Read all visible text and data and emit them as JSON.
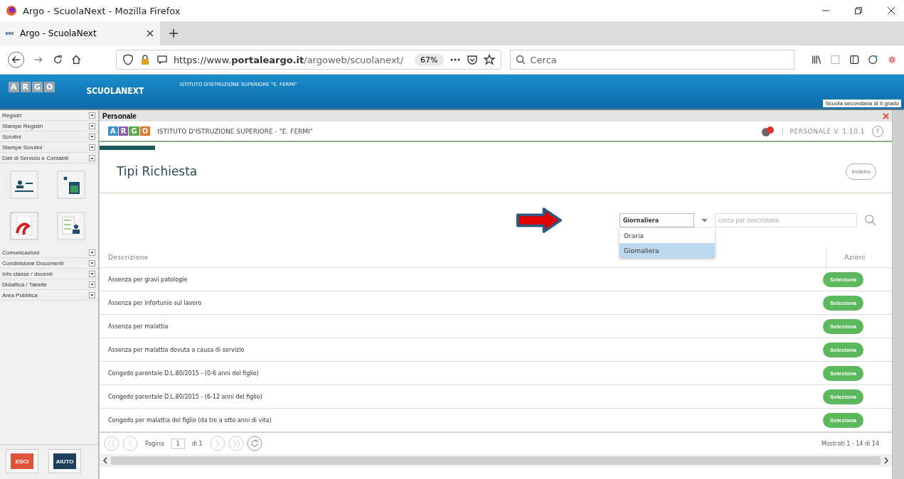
{
  "browser": {
    "window_title": "Argo - ScuolaNext - Mozilla Firefox",
    "tab_title": "Argo - ScuolaNext",
    "url_prefix": "https://www.",
    "url_domain": "portaleargo.it",
    "url_path": "/argoweb/scuolanext/",
    "zoom": "67%",
    "search_placeholder": "Cerca"
  },
  "app_header": {
    "logo_letters": [
      "A",
      "R",
      "G",
      "O"
    ],
    "product": "SCUOLANEXT",
    "school": "ISTITUTO D'ISTRUZIONE SUPERIORE \"E. FERMI\"",
    "school_level": "Scuola secondaria di II grado"
  },
  "sidebar": {
    "items": [
      {
        "label": "Registri",
        "expanded": false
      },
      {
        "label": "Stampe Registri",
        "expanded": false
      },
      {
        "label": "Scrutini",
        "expanded": false
      },
      {
        "label": "Stampe Scrutini",
        "expanded": false
      },
      {
        "label": "Dati di Servizio e Contabili",
        "expanded": true
      },
      {
        "label": "Comunicazioni",
        "expanded": false
      },
      {
        "label": "Condivisione Documenti",
        "expanded": false
      },
      {
        "label": "Info classe / docenti",
        "expanded": false
      },
      {
        "label": "Didattica / Tabelle",
        "expanded": false
      },
      {
        "label": "Area Pubblica",
        "expanded": false
      }
    ],
    "bottom_buttons": [
      {
        "label": "ESCI",
        "kind": "exit"
      },
      {
        "label": "AIUTO",
        "kind": "help"
      }
    ]
  },
  "panel": {
    "title": "Personale",
    "logo_letters": [
      {
        "letter": "A",
        "color": "#3a8fd0"
      },
      {
        "letter": "R",
        "color": "#8a5bb5"
      },
      {
        "letter": "G",
        "color": "#5aa84a"
      },
      {
        "letter": "O",
        "color": "#e8742c"
      }
    ],
    "school": "ISTITUTO D'ISTRUZIONE SUPERIORE - \"E. FERMI\"",
    "version": "PERSONALE V. 1.10.1",
    "help": "?",
    "progress": {
      "level": 0.07
    },
    "page_title": "Tipi Richiesta",
    "back_button": "Indietro",
    "filter": {
      "select_value": "Giornaliera",
      "options": [
        {
          "label": "Oraria",
          "selected": false
        },
        {
          "label": "Giornaliera",
          "selected": true
        }
      ],
      "search_placeholder": "cerca per descrizione"
    },
    "table": {
      "columns": [
        "Descrizione",
        "Azioni"
      ],
      "rows": [
        {
          "description": "Assenza per gravi patologie",
          "action": "Seleziona"
        },
        {
          "description": "Assenza per infortunio sul lavoro",
          "action": "Seleziona"
        },
        {
          "description": "Assenza per malattia",
          "action": "Seleziona"
        },
        {
          "description": "Assenza per malattia dovuta a causa di servizio",
          "action": "Seleziona"
        },
        {
          "description": "Congedo parentale D.L.80/2015 - (0-6 anni del figlio)",
          "action": "Seleziona"
        },
        {
          "description": "Congedo parentale D.L.80/2015 - (6-12 anni del figlio)",
          "action": "Seleziona"
        },
        {
          "description": "Congedo per malattia del figlio (da tre a otto anni di vita)",
          "action": "Seleziona"
        }
      ]
    },
    "pager": {
      "label": "Pagina",
      "page": "1",
      "of": "di 1",
      "summary": "Mostrati 1 - 14 di 14"
    }
  }
}
